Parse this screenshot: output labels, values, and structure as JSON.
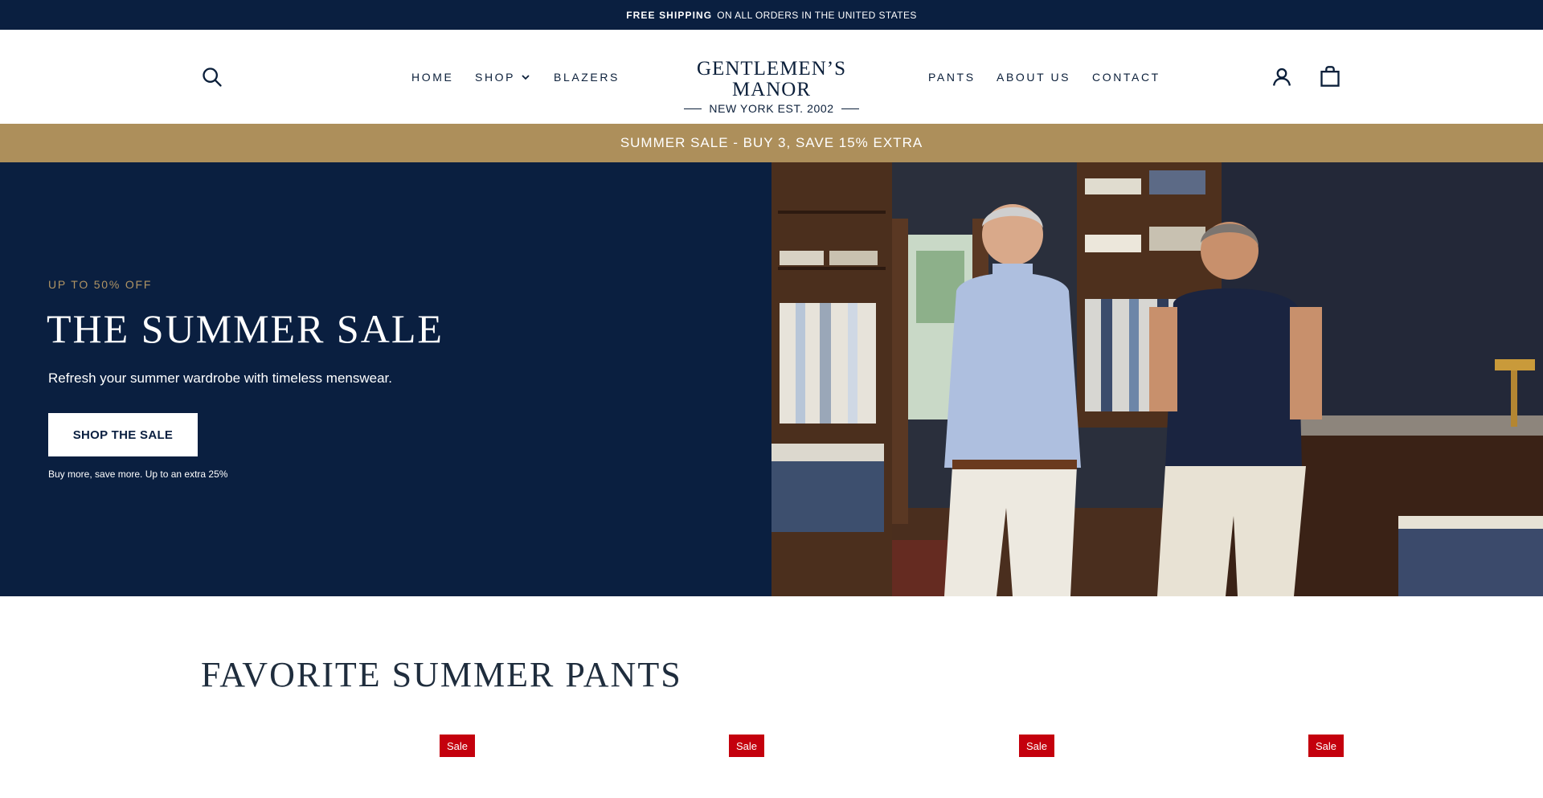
{
  "announcement": {
    "bold": "FREE SHIPPING",
    "text": "ON ALL ORDERS IN THE UNITED STATES"
  },
  "header": {
    "search_icon": "search-icon",
    "nav_left": [
      {
        "label": "HOME"
      },
      {
        "label": "SHOP",
        "icon": "chevron-down-icon"
      },
      {
        "label": "BLAZERS"
      }
    ],
    "logo": {
      "title": "GENTLEMEN’S MANOR",
      "subtitle": "NEW YORK EST. 2002"
    },
    "nav_right": [
      {
        "label": "PANTS"
      },
      {
        "label": "ABOUT US"
      },
      {
        "label": "CONTACT"
      }
    ],
    "account_icon": "user-icon",
    "cart_icon": "shopping-bag-icon"
  },
  "promo_strip": {
    "text": "SUMMER SALE - BUY 3, SAVE 15% EXTRA"
  },
  "hero": {
    "eyebrow": "UP TO 50% OFF",
    "title": "THE SUMMER SALE",
    "subtitle": "Refresh your summer wardrobe with timeless menswear.",
    "cta": "SHOP THE SALE",
    "note": "Buy more, save more. Up to an extra 25%"
  },
  "section": {
    "title": "FAVORITE SUMMER PANTS",
    "badges": [
      "Sale",
      "Sale",
      "Sale",
      "Sale"
    ]
  },
  "colors": {
    "navy": "#0a1f40",
    "gold": "#ad8f5b",
    "eyebrow_gold": "#b09464",
    "sale_red": "#c4000d",
    "white": "#ffffff"
  }
}
